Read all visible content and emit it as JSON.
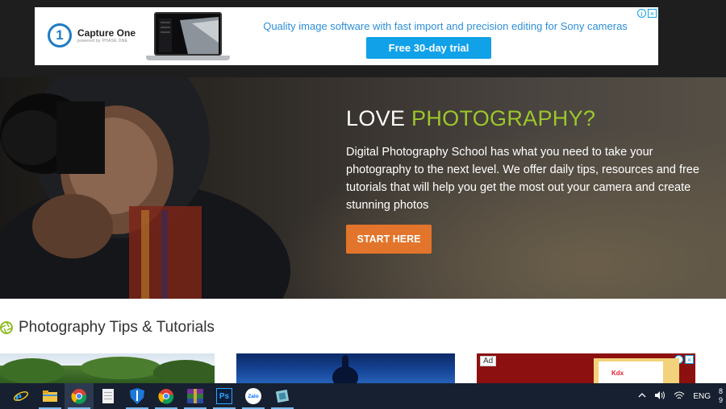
{
  "ad": {
    "brand": "Capture One",
    "brand_sub": "powered by PHASE ONE",
    "logo_digit": "1",
    "text": "Quality image software with fast import and precision editing for Sony cameras",
    "cta": "Free 30-day trial",
    "adchoices_i": "i",
    "adchoices_x": "×"
  },
  "hero": {
    "title_plain": "LOVE ",
    "title_accent": "PHOTOGRAPHY?",
    "description": "Digital Photography School has what you need to take your photography to the next level. We offer daily tips, resources and free tutorials that will help you get the most out your camera and create stunning photos",
    "button": "START HERE"
  },
  "section": {
    "title": "Photography Tips & Tutorials"
  },
  "cards": {
    "ad_label": "Ad",
    "adchoices_i": "i",
    "adchoices_x": "×"
  },
  "taskbar": {
    "apps": [
      "internet-explorer-icon",
      "file-explorer-icon",
      "chrome-icon",
      "notepad-icon",
      "windows-defender-icon",
      "chrome-icon",
      "winrar-icon",
      "photoshop-icon",
      "zalo-icon",
      "app-icon"
    ],
    "zalo_label": "Zalo",
    "ps_label": "Ps",
    "language": "ENG",
    "clock_line1": "8",
    "clock_line2": "9"
  },
  "colors": {
    "accent_green": "#9cc72a",
    "cta_orange": "#e2752b",
    "ad_blue": "#2d8ed6",
    "ad_button": "#11a1e8",
    "taskbar": "#162030"
  }
}
